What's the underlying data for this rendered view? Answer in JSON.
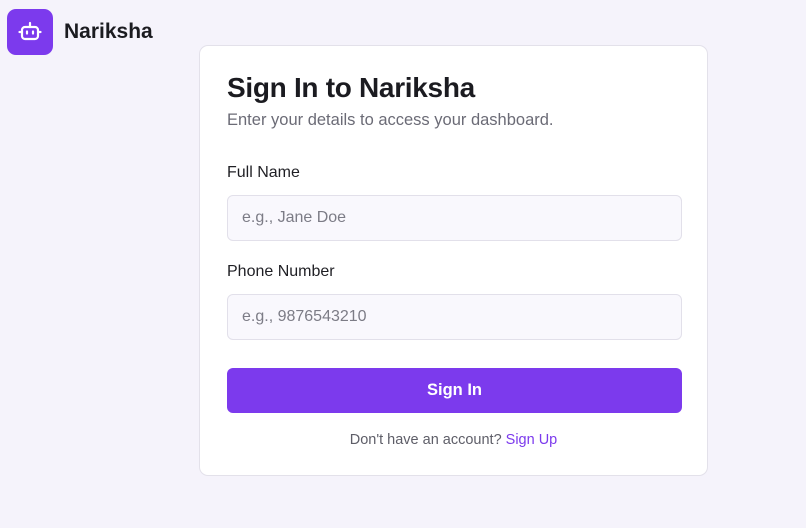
{
  "brand": {
    "name": "Nariksha",
    "logo_icon": "robot-icon",
    "accent_color": "#7c3aed"
  },
  "card": {
    "title": "Sign In to Nariksha",
    "subtitle": "Enter your details to access your dashboard."
  },
  "form": {
    "full_name": {
      "label": "Full Name",
      "value": "",
      "placeholder": "e.g., Jane Doe"
    },
    "phone": {
      "label": "Phone Number",
      "value": "",
      "placeholder": "e.g., 9876543210"
    },
    "submit_label": "Sign In"
  },
  "footer": {
    "prompt": "Don't have an account?",
    "link_label": "Sign Up"
  }
}
